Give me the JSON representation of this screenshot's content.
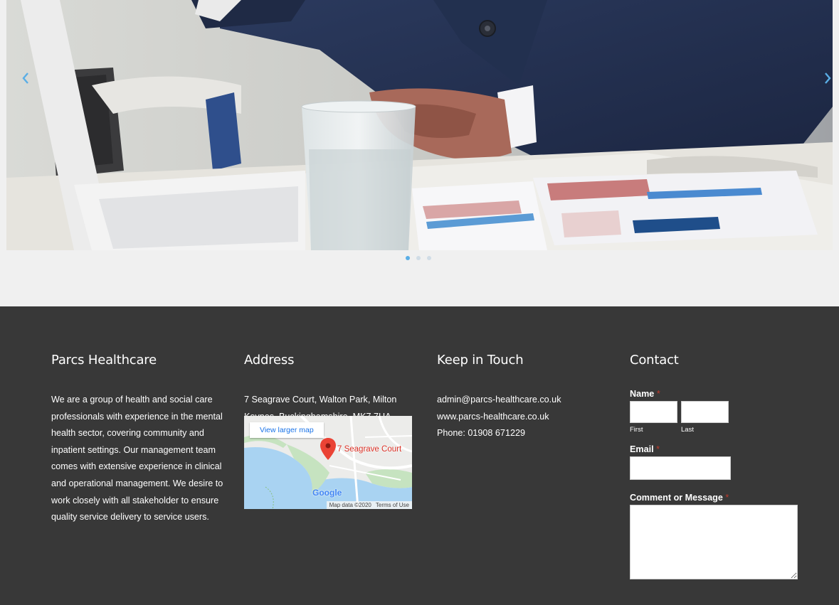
{
  "slider": {
    "prev_icon": "chevron-left-icon",
    "next_icon": "chevron-right-icon",
    "dots": [
      {
        "state": "active"
      },
      {
        "state": "inactive"
      },
      {
        "state": "inactive"
      }
    ],
    "accent": "#5aaee6"
  },
  "footer": {
    "background": "#383838",
    "about": {
      "title": "Parcs Healthcare",
      "text": "We are a group of health and social care professionals with experience in the mental health sector, covering community and inpatient settings. Our management team comes with extensive experience in clinical and operational management. We desire to work closely with all stakeholder to ensure quality service delivery to service users."
    },
    "address": {
      "title": "Address",
      "text": "7 Seagrave Court, Walton Park, Milton Keynes, Buckinghamshire, MK7 7HA.",
      "map": {
        "larger_map": "View larger map",
        "place_label": "7 Seagrave Court",
        "google": "Google",
        "map_data": "Map data ©2020",
        "terms": "Terms of Use"
      }
    },
    "touch": {
      "title": "Keep in Touch",
      "email": "admin@parcs-healthcare.co.uk",
      "website": "www.parcs-healthcare.co.uk",
      "phone": "Phone: 01908 671229"
    },
    "contact": {
      "title": "Contact",
      "name_label": "Name",
      "first_label": "First",
      "last_label": "Last",
      "email_label": "Email",
      "message_label": "Comment or Message",
      "required_mark": "*",
      "required_color": "#c0392b"
    }
  }
}
